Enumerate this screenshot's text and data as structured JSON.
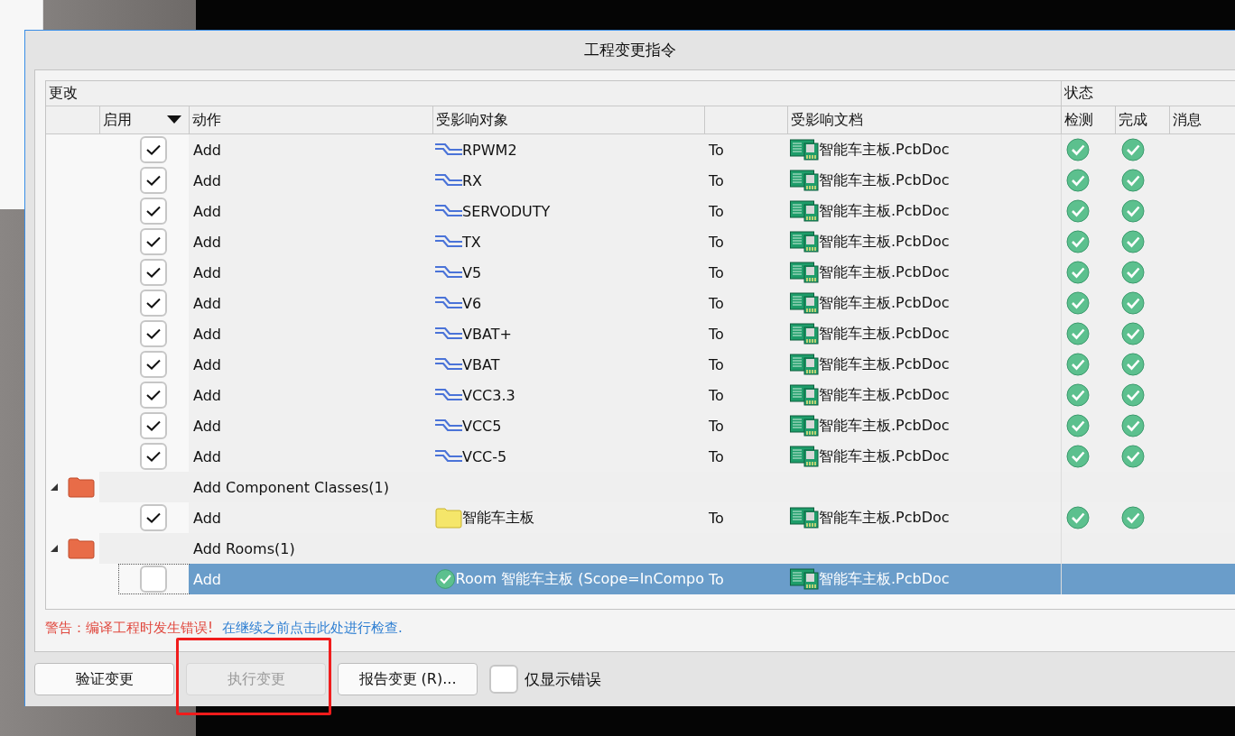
{
  "window": {
    "title": "工程变更指令"
  },
  "table": {
    "group_headers": [
      "更改",
      "状态"
    ],
    "columns": [
      "启用",
      "动作",
      "受影响对象",
      "受影响文档",
      "检测",
      "完成",
      "消息"
    ],
    "rows": [
      {
        "kind": "item",
        "checked": true,
        "selected": false,
        "action": "Add",
        "object": {
          "kind": "net",
          "name": "RPWM2"
        },
        "direction": "To",
        "document": "智能车主板.PcbDoc",
        "check": true,
        "done": true
      },
      {
        "kind": "item",
        "checked": true,
        "selected": false,
        "action": "Add",
        "object": {
          "kind": "net",
          "name": "RX"
        },
        "direction": "To",
        "document": "智能车主板.PcbDoc",
        "check": true,
        "done": true
      },
      {
        "kind": "item",
        "checked": true,
        "selected": false,
        "action": "Add",
        "object": {
          "kind": "net",
          "name": "SERVODUTY"
        },
        "direction": "To",
        "document": "智能车主板.PcbDoc",
        "check": true,
        "done": true
      },
      {
        "kind": "item",
        "checked": true,
        "selected": false,
        "action": "Add",
        "object": {
          "kind": "net",
          "name": "TX"
        },
        "direction": "To",
        "document": "智能车主板.PcbDoc",
        "check": true,
        "done": true
      },
      {
        "kind": "item",
        "checked": true,
        "selected": false,
        "action": "Add",
        "object": {
          "kind": "net",
          "name": "V5"
        },
        "direction": "To",
        "document": "智能车主板.PcbDoc",
        "check": true,
        "done": true
      },
      {
        "kind": "item",
        "checked": true,
        "selected": false,
        "action": "Add",
        "object": {
          "kind": "net",
          "name": "V6"
        },
        "direction": "To",
        "document": "智能车主板.PcbDoc",
        "check": true,
        "done": true
      },
      {
        "kind": "item",
        "checked": true,
        "selected": false,
        "action": "Add",
        "object": {
          "kind": "net",
          "name": "VBAT+"
        },
        "direction": "To",
        "document": "智能车主板.PcbDoc",
        "check": true,
        "done": true
      },
      {
        "kind": "item",
        "checked": true,
        "selected": false,
        "action": "Add",
        "object": {
          "kind": "net",
          "name": "VBAT"
        },
        "direction": "To",
        "document": "智能车主板.PcbDoc",
        "check": true,
        "done": true
      },
      {
        "kind": "item",
        "checked": true,
        "selected": false,
        "action": "Add",
        "object": {
          "kind": "net",
          "name": "VCC3.3"
        },
        "direction": "To",
        "document": "智能车主板.PcbDoc",
        "check": true,
        "done": true
      },
      {
        "kind": "item",
        "checked": true,
        "selected": false,
        "action": "Add",
        "object": {
          "kind": "net",
          "name": "VCC5"
        },
        "direction": "To",
        "document": "智能车主板.PcbDoc",
        "check": true,
        "done": true
      },
      {
        "kind": "item",
        "checked": true,
        "selected": false,
        "action": "Add",
        "object": {
          "kind": "net",
          "name": "VCC-5"
        },
        "direction": "To",
        "document": "智能车主板.PcbDoc",
        "check": true,
        "done": true
      },
      {
        "kind": "group",
        "expanded": true,
        "label": "Add Component Classes(1)"
      },
      {
        "kind": "item",
        "checked": true,
        "selected": false,
        "action": "Add",
        "object": {
          "kind": "folder",
          "name": "智能车主板"
        },
        "direction": "To",
        "document": "智能车主板.PcbDoc",
        "check": true,
        "done": true
      },
      {
        "kind": "group",
        "expanded": true,
        "label": "Add Rooms(1)"
      },
      {
        "kind": "item",
        "checked": false,
        "selected": true,
        "action": "Add",
        "object": {
          "kind": "room",
          "name": "Room 智能车主板 (Scope=InCompo"
        },
        "direction": "To",
        "document": "智能车主板.PcbDoc",
        "check": false,
        "done": false
      }
    ]
  },
  "warning": {
    "message": "警告：编译工程时发生错误!",
    "link": "在继续之前点击此处进行检查."
  },
  "buttons": [
    {
      "label": "验证变更",
      "disabled": false,
      "highlighted": false
    },
    {
      "label": "执行变更",
      "disabled": true,
      "highlighted": true
    },
    {
      "label": "报告变更 (R)...",
      "disabled": false,
      "highlighted": false
    }
  ],
  "only_errors": {
    "label": "仅显示错误",
    "checked": false
  }
}
